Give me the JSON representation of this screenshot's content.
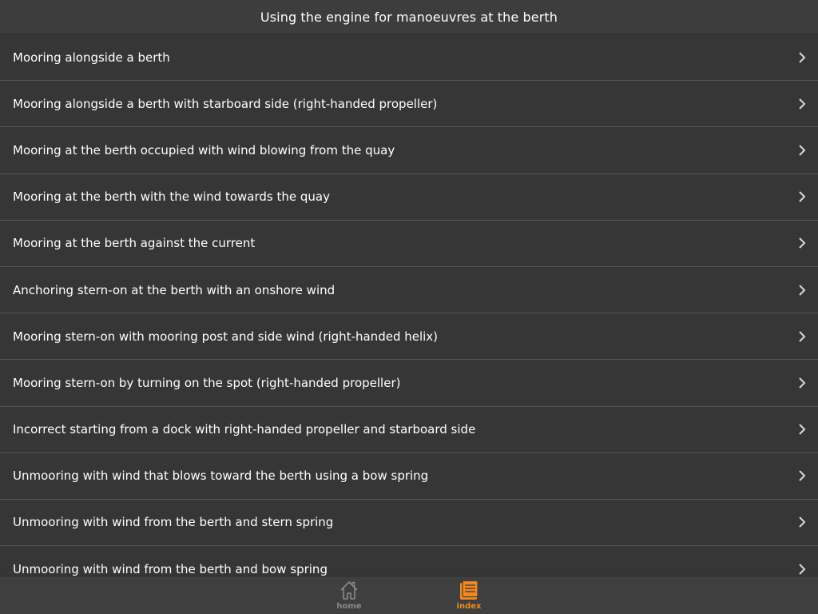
{
  "header": {
    "title": "Using the engine for manoeuvres at the berth"
  },
  "list": {
    "items": [
      {
        "label": "Mooring alongside a berth"
      },
      {
        "label": "Mooring alongside a berth with starboard side (right-handed propeller)"
      },
      {
        "label": "Mooring at the berth occupied with wind blowing from the quay"
      },
      {
        "label": "Mooring at the berth with the wind towards the quay"
      },
      {
        "label": "Mooring at the berth against the current"
      },
      {
        "label": "Anchoring stern-on at the berth with an onshore wind"
      },
      {
        "label": "Mooring stern-on with mooring post and side wind (right-handed helix)"
      },
      {
        "label": "Mooring stern-on by turning on the spot (right-handed propeller)"
      },
      {
        "label": "Incorrect starting from a dock with right-handed propeller and starboard side"
      },
      {
        "label": "Unmooring with wind that blows toward the berth using a bow spring"
      },
      {
        "label": "Unmooring with wind from the berth and stern spring"
      },
      {
        "label": "Unmooring with wind from the berth and bow spring"
      }
    ]
  },
  "tabbar": {
    "home": {
      "label": "home",
      "icon": "home-icon",
      "active": false
    },
    "index": {
      "label": "index",
      "icon": "index-icon",
      "active": true
    }
  },
  "colors": {
    "background": "#363636",
    "header": "#3d3d3d",
    "separator": "#555555",
    "accent": "#f38a1f",
    "inactive": "#8a8a8a"
  }
}
